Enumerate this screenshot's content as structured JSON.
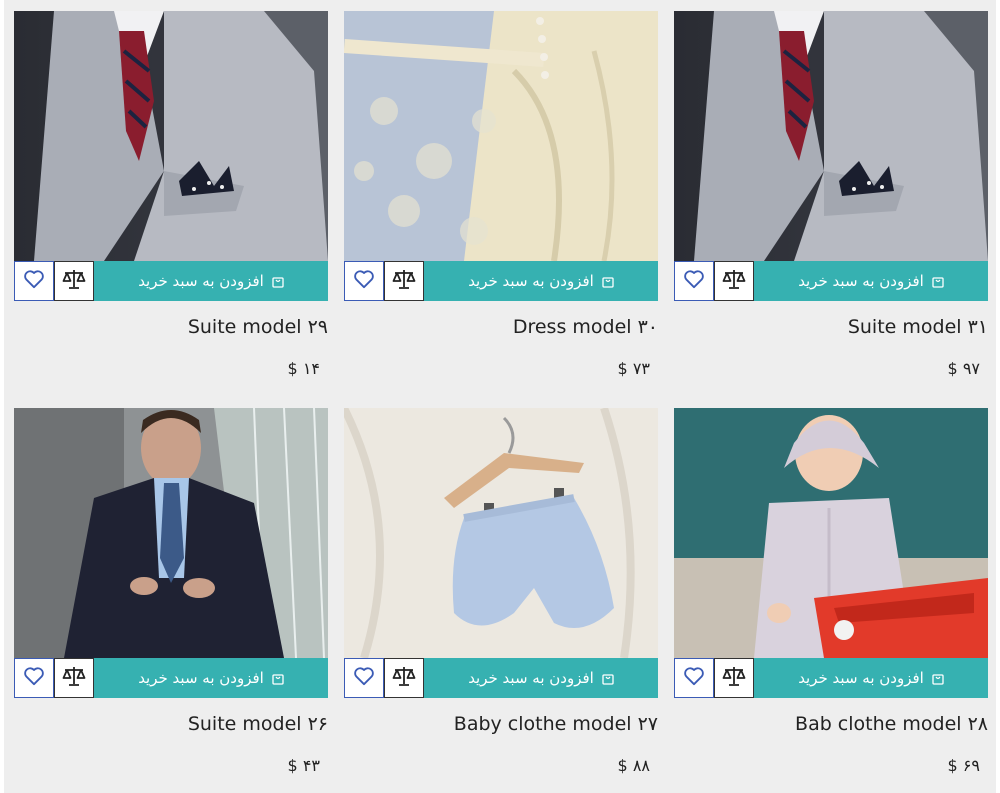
{
  "products": [
    {
      "name": "Suite model ۲۹",
      "price": "$ ۱۴",
      "add_label": "افزودن به سبد خرید",
      "image": "suit-gray"
    },
    {
      "name": "Dress model ۳۰",
      "price": "$ ۷۳",
      "add_label": "افزودن به سبد خرید",
      "image": "dress-lace"
    },
    {
      "name": "Suite model ۳۱",
      "price": "$ ۹۷",
      "add_label": "افزودن به سبد خرید",
      "image": "suit-gray"
    },
    {
      "name": "Suite model ۲۶",
      "price": "$ ۴۳",
      "add_label": "افزودن به سبد خرید",
      "image": "man-navy-suit"
    },
    {
      "name": "Baby clothe model ۲۷",
      "price": "$ ۸۸",
      "add_label": "افزودن به سبد خرید",
      "image": "baby-shorts-hanger"
    },
    {
      "name": "Bab clothe model ۲۸",
      "price": "$ ۶۹",
      "add_label": "افزودن به سبد خرید",
      "image": "baby-toy"
    }
  ],
  "colors": {
    "accent": "#36b1b1",
    "fav_border": "#3b5bb5",
    "background": "#eeeeee"
  }
}
